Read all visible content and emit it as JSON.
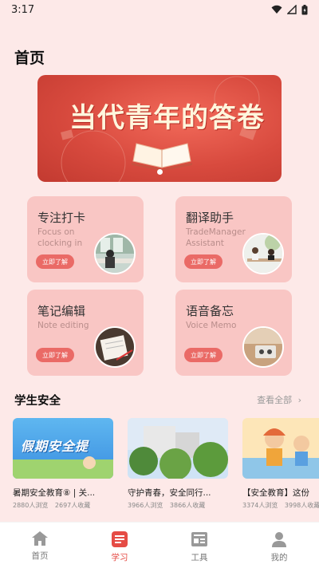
{
  "status_bar": {
    "time": "3:17"
  },
  "page": {
    "title": "首页"
  },
  "banner": {
    "text": "当代青年的答卷",
    "dots": 1
  },
  "features": [
    {
      "title": "专注打卡",
      "subtitle": "Focus on clocking in",
      "button": "立即了解",
      "photo_icon": "study-photo"
    },
    {
      "title": "翻译助手",
      "subtitle": "TradeManager Assistant",
      "button": "立即了解",
      "photo_icon": "meeting-photo"
    },
    {
      "title": "笔记编辑",
      "subtitle": "Note editing",
      "button": "立即了解",
      "photo_icon": "notebook-photo"
    },
    {
      "title": "语音备忘",
      "subtitle": "Voice Memo",
      "button": "立即了解",
      "photo_icon": "voice-photo"
    }
  ],
  "safety": {
    "title": "学生安全",
    "see_all": "查看全部",
    "articles": [
      {
        "title": "暑期安全教育⑧ | 关...",
        "views": "2880人浏览",
        "favorites": "2697人收藏",
        "image_text": "假期安全提"
      },
      {
        "title": "守护青春，安全同行...",
        "views": "3966人浏览",
        "favorites": "3866人收藏",
        "image_text": ""
      },
      {
        "title": "【安全教育】这份",
        "views": "3374人浏览",
        "favorites": "3998人收藏",
        "image_text": ""
      }
    ]
  },
  "nav": {
    "items": [
      {
        "label": "首页",
        "icon": "home-icon"
      },
      {
        "label": "学习",
        "icon": "study-icon"
      },
      {
        "label": "工具",
        "icon": "tools-icon"
      },
      {
        "label": "我的",
        "icon": "profile-icon"
      }
    ],
    "active_index": 1,
    "active_color": "#e54c45"
  },
  "colors": {
    "background": "#fde9e8",
    "card": "#f9c6c4",
    "accent": "#ea6a66"
  }
}
